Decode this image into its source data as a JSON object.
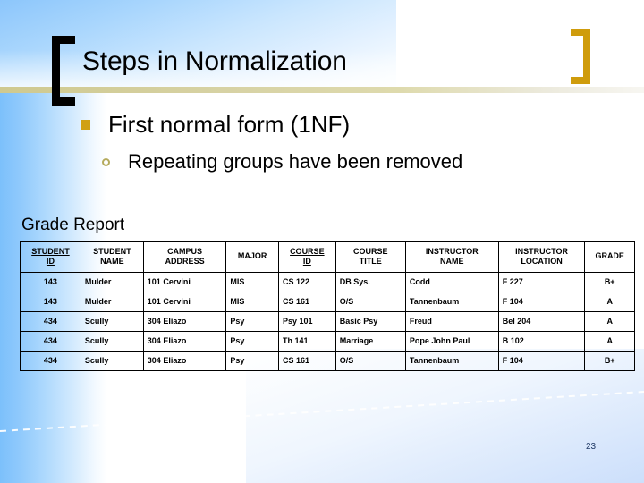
{
  "slide": {
    "title": "Steps in Normalization",
    "number": "23",
    "colors": {
      "accent_gold": "#cf9c0c",
      "bracket_black": "#000000",
      "khaki_rule": "#d7d2a4",
      "banner_blue": "#8cc6fb",
      "slide_number": "#1f3864"
    }
  },
  "bullets": {
    "level1": "First normal form (1NF)",
    "level2": "Repeating groups have been removed"
  },
  "report": {
    "caption": "Grade Report",
    "columns": [
      {
        "line1": "STUDENT",
        "line2": "ID",
        "key": true
      },
      {
        "line1": "STUDENT",
        "line2": "NAME",
        "key": false
      },
      {
        "line1": "CAMPUS",
        "line2": "ADDRESS",
        "key": false
      },
      {
        "line1": "MAJOR",
        "line2": "",
        "key": false
      },
      {
        "line1": "COURSE",
        "line2": "ID",
        "key": true
      },
      {
        "line1": "COURSE",
        "line2": "TITLE",
        "key": false
      },
      {
        "line1": "INSTRUCTOR",
        "line2": "NAME",
        "key": false
      },
      {
        "line1": "INSTRUCTOR",
        "line2": "LOCATION",
        "key": false
      },
      {
        "line1": "GRADE",
        "line2": "",
        "key": false
      }
    ],
    "rows": [
      [
        "143",
        "Mulder",
        "101 Cervini",
        "MIS",
        "CS 122",
        "DB Sys.",
        "Codd",
        "F 227",
        "B+"
      ],
      [
        "143",
        "Mulder",
        "101 Cervini",
        "MIS",
        "CS 161",
        "O/S",
        "Tannenbaum",
        "F 104",
        "A"
      ],
      [
        "434",
        "Scully",
        "304 Eliazo",
        "Psy",
        "Psy 101",
        "Basic Psy",
        "Freud",
        "Bel 204",
        "A"
      ],
      [
        "434",
        "Scully",
        "304 Eliazo",
        "Psy",
        "Th 141",
        "Marriage",
        "Pope John Paul",
        "B 102",
        "A"
      ],
      [
        "434",
        "Scully",
        "304 Eliazo",
        "Psy",
        "CS 161",
        "O/S",
        "Tannenbaum",
        "F 104",
        "B+"
      ]
    ]
  }
}
